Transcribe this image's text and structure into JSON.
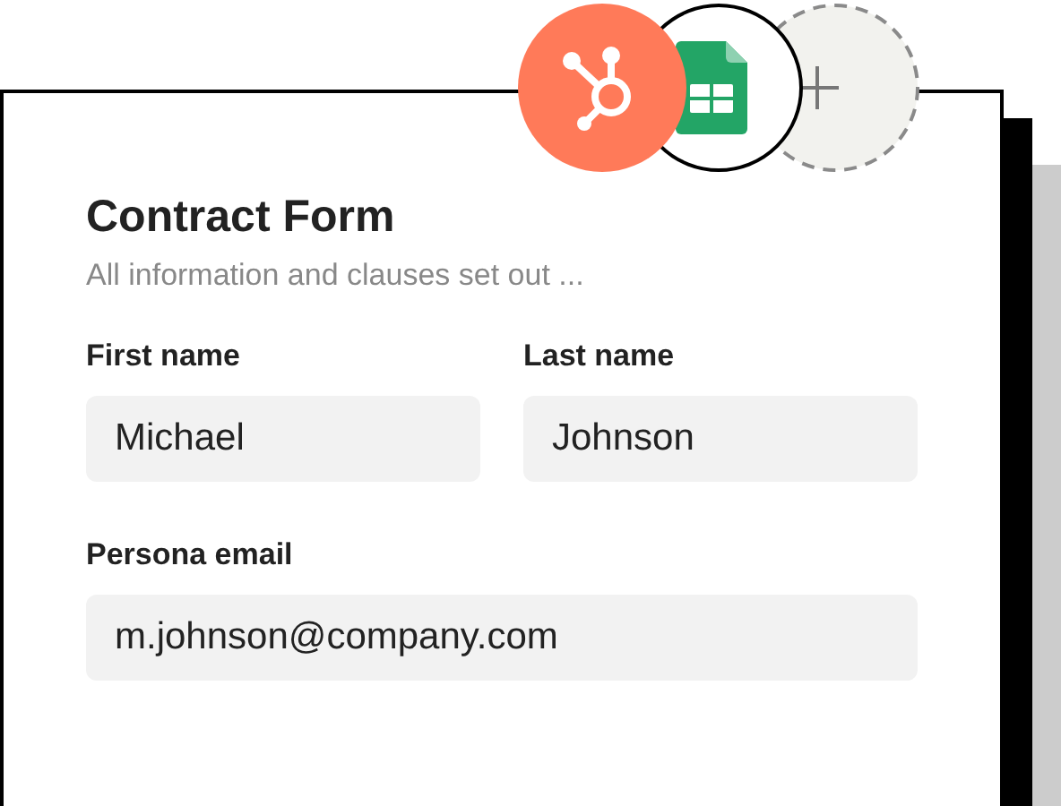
{
  "integrations": [
    {
      "kind": "hubspot"
    },
    {
      "kind": "sheets"
    },
    {
      "kind": "add"
    }
  ],
  "form": {
    "title": "Contract Form",
    "subtitle": "All information and clauses set out ...",
    "rows": [
      [
        {
          "label": "First name",
          "value": "Michael"
        },
        {
          "label": "Last name",
          "value": "Johnson"
        }
      ],
      [
        {
          "label": "Persona email",
          "value": "m.johnson@company.com"
        }
      ]
    ]
  }
}
